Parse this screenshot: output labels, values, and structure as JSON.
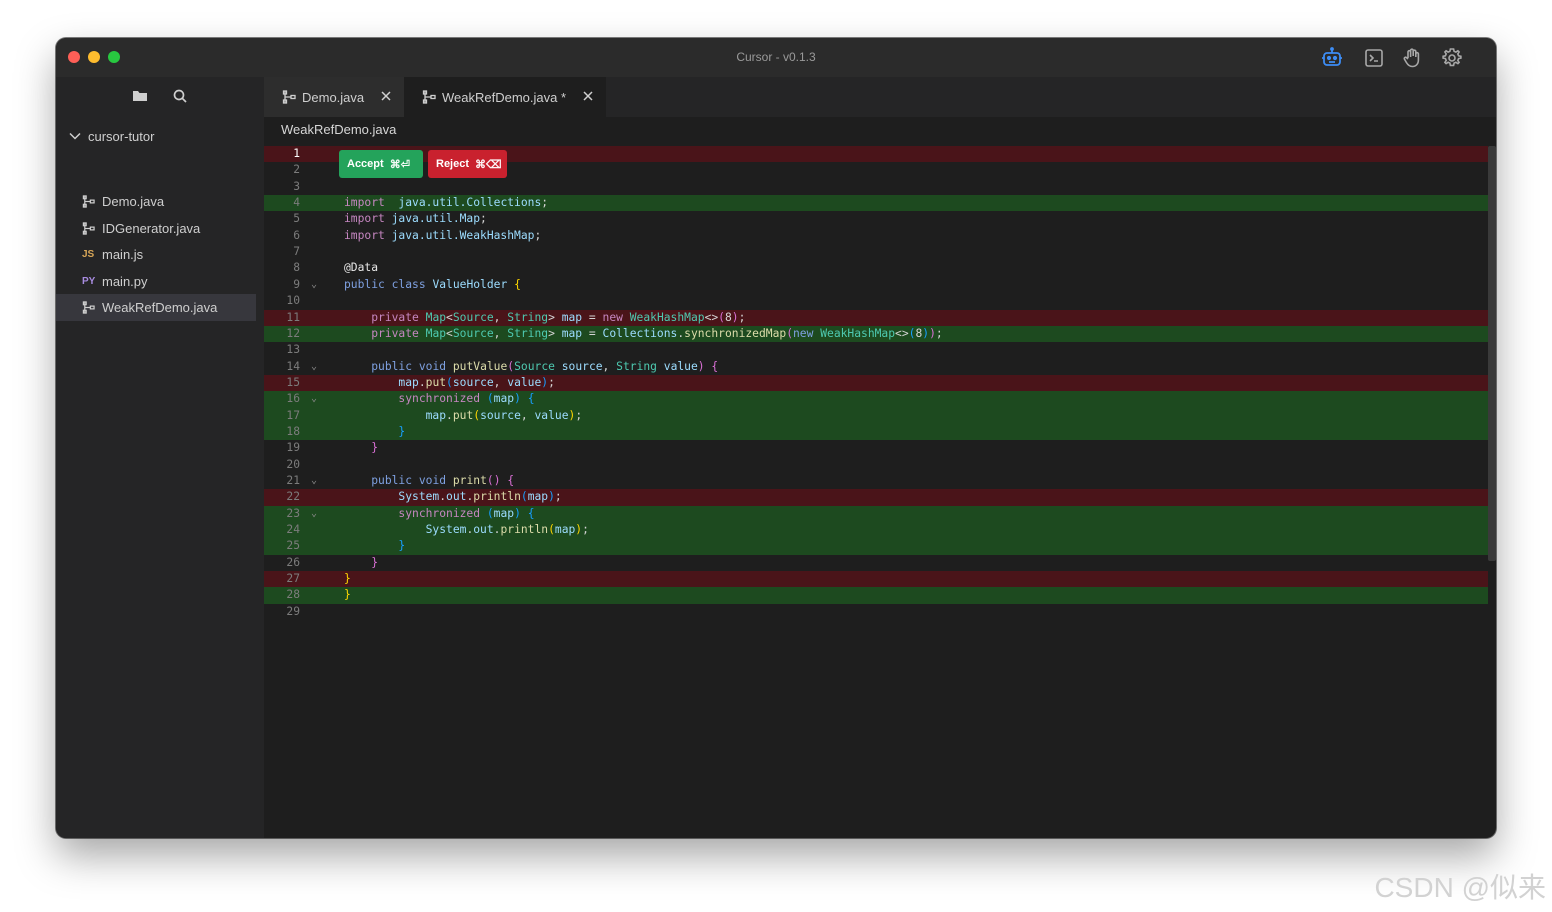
{
  "window": {
    "title": "Cursor - v0.1.3"
  },
  "titlebar_icons": [
    "robot-icon",
    "terminal-icon",
    "hand-icon",
    "gear-icon"
  ],
  "sidebar": {
    "root": "cursor-tutor",
    "files": [
      {
        "name": "Demo.java",
        "icon": "java",
        "active": false
      },
      {
        "name": "IDGenerator.java",
        "icon": "java",
        "active": false
      },
      {
        "name": "main.js",
        "icon": "JS",
        "active": false
      },
      {
        "name": "main.py",
        "icon": "PY",
        "active": false
      },
      {
        "name": "WeakRefDemo.java",
        "icon": "java",
        "active": true
      }
    ]
  },
  "tabs": [
    {
      "label": "Demo.java",
      "active": false
    },
    {
      "label": "WeakRefDemo.java *",
      "active": true
    }
  ],
  "breadcrumb": "WeakRefDemo.java",
  "diff_actions": {
    "accept_label": "Accept",
    "accept_shortcut": "⌘⏎",
    "reject_label": "Reject",
    "reject_shortcut": "⌘⌫"
  },
  "colors": {
    "deleted_line_bg": "#4a1419",
    "added_line_bg": "#1d4a1f",
    "accept_bg": "#24a35b",
    "reject_bg": "#c9212e"
  },
  "editor": {
    "current_line": 1,
    "lines": [
      {
        "n": 1,
        "state": "del",
        "fold": false,
        "tokens": []
      },
      {
        "n": 2,
        "state": "",
        "fold": false,
        "tokens": []
      },
      {
        "n": 3,
        "state": "",
        "fold": false,
        "tokens": []
      },
      {
        "n": 4,
        "state": "add",
        "fold": false,
        "tokens": [
          [
            "kw",
            "import"
          ],
          [
            "",
            "  "
          ],
          [
            "id",
            "java.util.Collections"
          ],
          [
            "",
            ";"
          ]
        ]
      },
      {
        "n": 5,
        "state": "",
        "fold": false,
        "tokens": [
          [
            "kw",
            "import"
          ],
          [
            "",
            ""
          ],
          [
            "id",
            " java.util.Map"
          ],
          [
            "",
            ";"
          ]
        ]
      },
      {
        "n": 6,
        "state": "",
        "fold": false,
        "tokens": [
          [
            "kw",
            "import"
          ],
          [
            "id",
            " java.util.WeakHashMap"
          ],
          [
            "",
            ";"
          ]
        ]
      },
      {
        "n": 7,
        "state": "",
        "fold": false,
        "tokens": []
      },
      {
        "n": 8,
        "state": "",
        "fold": false,
        "tokens": [
          [
            "an",
            "@Data"
          ]
        ]
      },
      {
        "n": 9,
        "state": "",
        "fold": true,
        "tokens": [
          [
            "kw2",
            "public"
          ],
          [
            "",
            " "
          ],
          [
            "kw2",
            "class"
          ],
          [
            "",
            " "
          ],
          [
            "id",
            "ValueHolder"
          ],
          [
            "",
            " "
          ],
          [
            "p1",
            "{"
          ]
        ]
      },
      {
        "n": 10,
        "state": "",
        "fold": false,
        "tokens": []
      },
      {
        "n": 11,
        "state": "del",
        "fold": false,
        "tokens": [
          [
            "",
            "    "
          ],
          [
            "kw",
            "private"
          ],
          [
            "",
            " "
          ],
          [
            "ty",
            "Map"
          ],
          [
            "",
            "<"
          ],
          [
            "ty",
            "Source"
          ],
          [
            "",
            ", "
          ],
          [
            "ty",
            "String"
          ],
          [
            "",
            "> "
          ],
          [
            "id",
            "map"
          ],
          [
            "",
            " = "
          ],
          [
            "kw",
            "new"
          ],
          [
            "",
            " "
          ],
          [
            "ty",
            "WeakHashMap"
          ],
          [
            "",
            "<>"
          ],
          [
            "p2",
            "("
          ],
          [
            "",
            "8"
          ],
          [
            "p2",
            ")"
          ],
          [
            "",
            ";"
          ]
        ]
      },
      {
        "n": 12,
        "state": "add",
        "fold": false,
        "tokens": [
          [
            "",
            "    "
          ],
          [
            "kw",
            "private"
          ],
          [
            "",
            " "
          ],
          [
            "ty",
            "Map"
          ],
          [
            "",
            "<"
          ],
          [
            "ty",
            "Source"
          ],
          [
            "",
            ", "
          ],
          [
            "ty",
            "String"
          ],
          [
            "",
            "> "
          ],
          [
            "id",
            "map"
          ],
          [
            "",
            " = "
          ],
          [
            "id",
            "Collections"
          ],
          [
            "",
            "."
          ],
          [
            "fn",
            "synchronizedMap"
          ],
          [
            "p2",
            "("
          ],
          [
            "kw2",
            "new"
          ],
          [
            "",
            " "
          ],
          [
            "ty",
            "WeakHashMap"
          ],
          [
            "",
            "<>"
          ],
          [
            "p3",
            "("
          ],
          [
            "",
            "8"
          ],
          [
            "p3",
            ")"
          ],
          [
            "p2",
            ")"
          ],
          [
            "",
            ";"
          ]
        ]
      },
      {
        "n": 13,
        "state": "",
        "fold": false,
        "tokens": []
      },
      {
        "n": 14,
        "state": "",
        "fold": true,
        "tokens": [
          [
            "",
            "    "
          ],
          [
            "kw2",
            "public"
          ],
          [
            "",
            " "
          ],
          [
            "kw2",
            "void"
          ],
          [
            "",
            " "
          ],
          [
            "fn",
            "putValue"
          ],
          [
            "p2",
            "("
          ],
          [
            "ty",
            "Source"
          ],
          [
            "",
            " "
          ],
          [
            "id",
            "source"
          ],
          [
            "",
            ", "
          ],
          [
            "ty",
            "String"
          ],
          [
            "",
            " "
          ],
          [
            "id",
            "value"
          ],
          [
            "p2",
            ")"
          ],
          [
            "",
            " "
          ],
          [
            "p2",
            "{"
          ]
        ]
      },
      {
        "n": 15,
        "state": "del",
        "fold": false,
        "tokens": [
          [
            "",
            "        "
          ],
          [
            "id",
            "map"
          ],
          [
            "",
            "."
          ],
          [
            "fn",
            "put"
          ],
          [
            "p3",
            "("
          ],
          [
            "id",
            "source"
          ],
          [
            "",
            ", "
          ],
          [
            "id",
            "value"
          ],
          [
            "p3",
            ")"
          ],
          [
            "",
            ";"
          ]
        ]
      },
      {
        "n": 16,
        "state": "add",
        "fold": true,
        "tokens": [
          [
            "",
            "        "
          ],
          [
            "kw",
            "synchronized"
          ],
          [
            "",
            " "
          ],
          [
            "p3",
            "("
          ],
          [
            "id",
            "map"
          ],
          [
            "p3",
            ")"
          ],
          [
            "",
            " "
          ],
          [
            "p3",
            "{"
          ]
        ]
      },
      {
        "n": 17,
        "state": "add",
        "fold": false,
        "tokens": [
          [
            "",
            "            "
          ],
          [
            "id",
            "map"
          ],
          [
            "",
            "."
          ],
          [
            "fn",
            "put"
          ],
          [
            "p1",
            "("
          ],
          [
            "id",
            "source"
          ],
          [
            "",
            ", "
          ],
          [
            "id",
            "value"
          ],
          [
            "p1",
            ")"
          ],
          [
            "",
            ";"
          ]
        ]
      },
      {
        "n": 18,
        "state": "add",
        "fold": false,
        "tokens": [
          [
            "",
            "        "
          ],
          [
            "p3",
            "}"
          ]
        ]
      },
      {
        "n": 19,
        "state": "",
        "fold": false,
        "tokens": [
          [
            "",
            "    "
          ],
          [
            "p2",
            "}"
          ]
        ]
      },
      {
        "n": 20,
        "state": "",
        "fold": false,
        "tokens": []
      },
      {
        "n": 21,
        "state": "",
        "fold": true,
        "tokens": [
          [
            "",
            "    "
          ],
          [
            "kw2",
            "public"
          ],
          [
            "",
            " "
          ],
          [
            "kw2",
            "void"
          ],
          [
            "",
            " "
          ],
          [
            "fn",
            "print"
          ],
          [
            "p2",
            "()"
          ],
          [
            "",
            " "
          ],
          [
            "p2",
            "{"
          ]
        ]
      },
      {
        "n": 22,
        "state": "del",
        "fold": false,
        "tokens": [
          [
            "",
            "        "
          ],
          [
            "id",
            "System"
          ],
          [
            "",
            "."
          ],
          [
            "id",
            "out"
          ],
          [
            "",
            "."
          ],
          [
            "fn",
            "println"
          ],
          [
            "p3",
            "("
          ],
          [
            "id",
            "map"
          ],
          [
            "p3",
            ")"
          ],
          [
            "",
            ";"
          ]
        ]
      },
      {
        "n": 23,
        "state": "add",
        "fold": true,
        "tokens": [
          [
            "",
            "        "
          ],
          [
            "kw",
            "synchronized"
          ],
          [
            "",
            " "
          ],
          [
            "p3",
            "("
          ],
          [
            "id",
            "map"
          ],
          [
            "p3",
            ")"
          ],
          [
            "",
            " "
          ],
          [
            "p3",
            "{"
          ]
        ]
      },
      {
        "n": 24,
        "state": "add",
        "fold": false,
        "tokens": [
          [
            "",
            "            "
          ],
          [
            "id",
            "System"
          ],
          [
            "",
            "."
          ],
          [
            "id",
            "out"
          ],
          [
            "",
            "."
          ],
          [
            "fn",
            "println"
          ],
          [
            "p1",
            "("
          ],
          [
            "id",
            "map"
          ],
          [
            "p1",
            ")"
          ],
          [
            "",
            ";"
          ]
        ]
      },
      {
        "n": 25,
        "state": "add",
        "fold": false,
        "tokens": [
          [
            "",
            "        "
          ],
          [
            "p3",
            "}"
          ]
        ]
      },
      {
        "n": 26,
        "state": "",
        "fold": false,
        "tokens": [
          [
            "",
            "    "
          ],
          [
            "p2",
            "}"
          ]
        ]
      },
      {
        "n": 27,
        "state": "del",
        "fold": false,
        "tokens": [
          [
            "p1",
            "}"
          ]
        ]
      },
      {
        "n": 28,
        "state": "add",
        "fold": false,
        "tokens": [
          [
            "p1",
            "}"
          ]
        ]
      },
      {
        "n": 29,
        "state": "",
        "fold": false,
        "tokens": []
      }
    ]
  },
  "watermark": "CSDN @似来"
}
